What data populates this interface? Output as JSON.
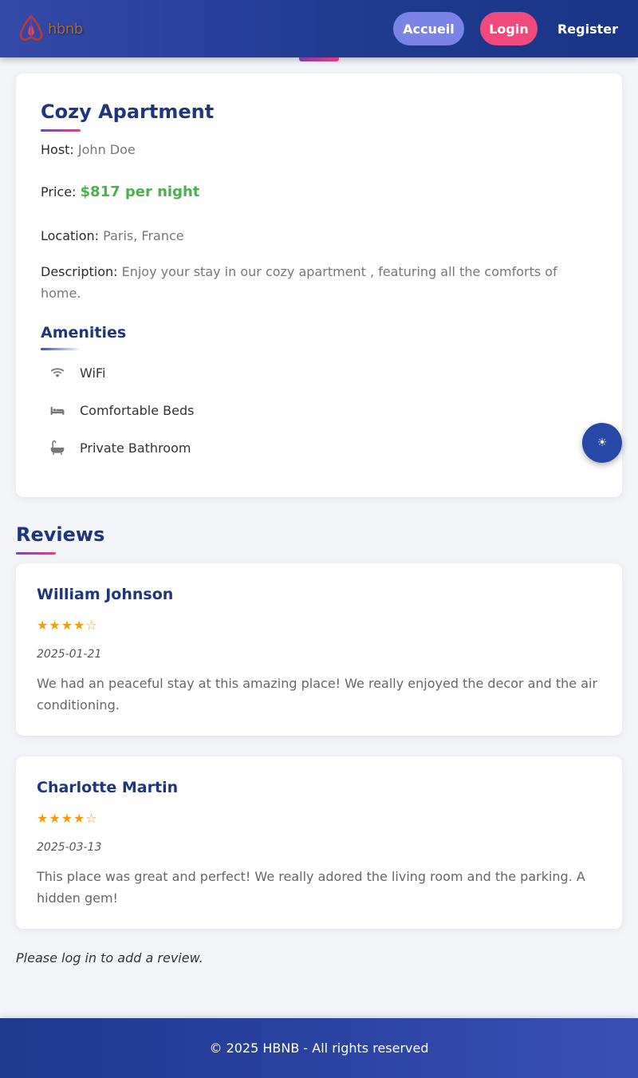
{
  "header": {
    "logo_text": "hbnb",
    "nav": {
      "accueil": "Accueil",
      "login": "Login",
      "register": "Register"
    }
  },
  "place": {
    "title": "Cozy Apartment",
    "host_label": "Host:",
    "host": "John Doe",
    "price_label": "Price:",
    "price": "$817 per night",
    "location_label": "Location:",
    "location": "Paris, France",
    "description_label": "Description:",
    "description": "Enjoy your stay in our cozy apartment , featuring all the comforts of home.",
    "amenities_title": "Amenities",
    "amenities": [
      {
        "icon": "wifi-icon",
        "label": "WiFi"
      },
      {
        "icon": "bed-icon",
        "label": "Comfortable Beds"
      },
      {
        "icon": "bathtub-icon",
        "label": "Private Bathroom"
      }
    ]
  },
  "theme_toggle": {
    "icon": "sun-icon",
    "glyph": "☀"
  },
  "reviews": {
    "title": "Reviews",
    "items": [
      {
        "name": "William Johnson",
        "stars": "★★★★☆",
        "rating": 4,
        "date": "2025-01-21",
        "text": "We had an peaceful stay at this amazing place! We really enjoyed the decor and the air conditioning."
      },
      {
        "name": "Charlotte Martin",
        "stars": "★★★★☆",
        "rating": 4,
        "date": "2025-03-13",
        "text": "This place was great and perfect! We really adored the living room and the parking. A hidden gem!"
      }
    ],
    "login_note": "Please log in to add a review."
  },
  "footer": {
    "text": "© 2025 HBNB - All rights reserved"
  },
  "colors": {
    "header": "#1f3a8f",
    "accent_pink": "#f04a7c",
    "accent_purple": "#7a84e6",
    "title_blue": "#1f3580",
    "price_green": "#4caf50",
    "star_orange": "#f39c12"
  }
}
